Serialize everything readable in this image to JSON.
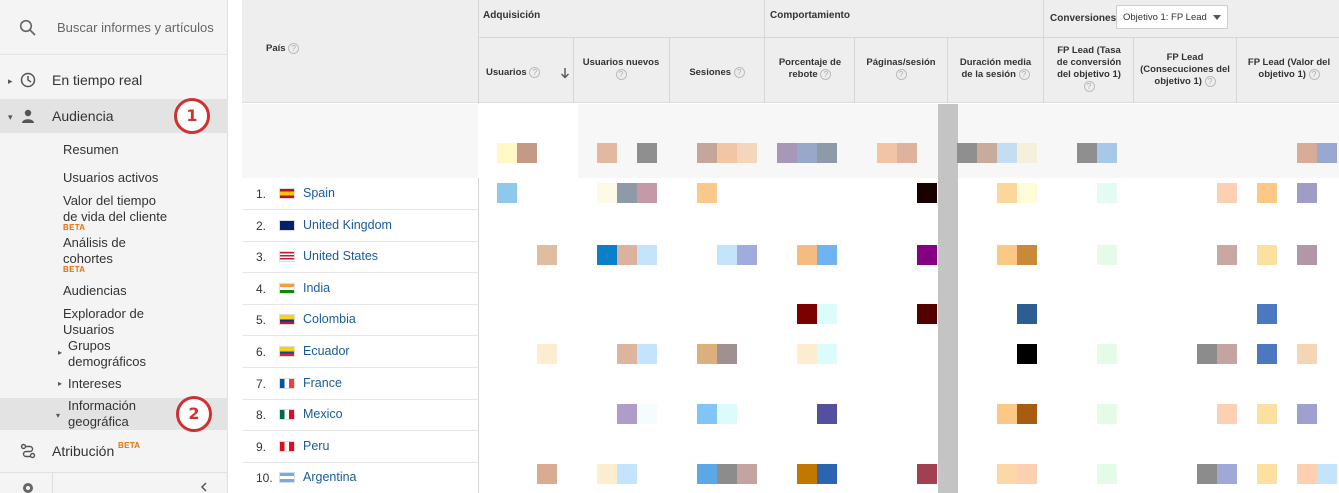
{
  "search": {
    "placeholder": "Buscar informes y artículos",
    "icon": "search-icon"
  },
  "nav": {
    "realtime": "En tiempo real",
    "audience": "Audiencia",
    "attribution": "Atribución",
    "attribution_badge": "BETA"
  },
  "audience_items": {
    "resumen": "Resumen",
    "usuarios_activos": "Usuarios activos",
    "valor_line1": "Valor del tiempo",
    "valor_line2": "de vida del cliente",
    "valor_badge": "BETA",
    "cohortes_line1": "Análisis de",
    "cohortes_line2": "cohortes",
    "cohortes_badge": "BETA",
    "audiencias": "Audiencias",
    "explorador_line1": "Explorador de",
    "explorador_line2": "Usuarios",
    "grupos_line1": "Grupos",
    "grupos_line2": "demográficos",
    "intereses": "Intereses",
    "geo_line1": "Información",
    "geo_line2": "geográfica"
  },
  "annotations": [
    "1",
    "2"
  ],
  "table": {
    "dimension_header": "País",
    "groups": {
      "adquisicion": "Adquisición",
      "comportamiento": "Comportamiento",
      "conversiones": "Conversiones"
    },
    "goal_select": "Objetivo 1: FP Lead",
    "columns": {
      "usuarios": "Usuarios",
      "usuarios_nuevos": "Usuarios nuevos",
      "sesiones": "Sesiones",
      "rebote_1": "Porcentaje de",
      "rebote_2": "rebote",
      "paginas": "Páginas/sesión",
      "duracion_1": "Duración media",
      "duracion_2": "de la sesión",
      "tasa_1": "FP Lead (Tasa",
      "tasa_2": "de conversión",
      "tasa_3": "del objetivo 1)",
      "consec_1": "FP Lead",
      "consec_2": "(Consecuciones del",
      "consec_3": "objetivo 1)",
      "valor_1": "FP Lead (Valor del",
      "valor_2": "objetivo 1)"
    },
    "rows": [
      {
        "n": "1.",
        "country": "Spain",
        "flag": "es"
      },
      {
        "n": "2.",
        "country": "United Kingdom",
        "flag": "gb"
      },
      {
        "n": "3.",
        "country": "United States",
        "flag": "us"
      },
      {
        "n": "4.",
        "country": "India",
        "flag": "in"
      },
      {
        "n": "5.",
        "country": "Colombia",
        "flag": "co"
      },
      {
        "n": "6.",
        "country": "Ecuador",
        "flag": "ec"
      },
      {
        "n": "7.",
        "country": "France",
        "flag": "fr"
      },
      {
        "n": "8.",
        "country": "Mexico",
        "flag": "mx"
      },
      {
        "n": "9.",
        "country": "Peru",
        "flag": "pe"
      },
      {
        "n": "10.",
        "country": "Argentina",
        "flag": "ar"
      }
    ]
  },
  "colors": {
    "link": "#1a5b9a",
    "annotation": "#d32f2f",
    "beta": "#e8710a"
  }
}
